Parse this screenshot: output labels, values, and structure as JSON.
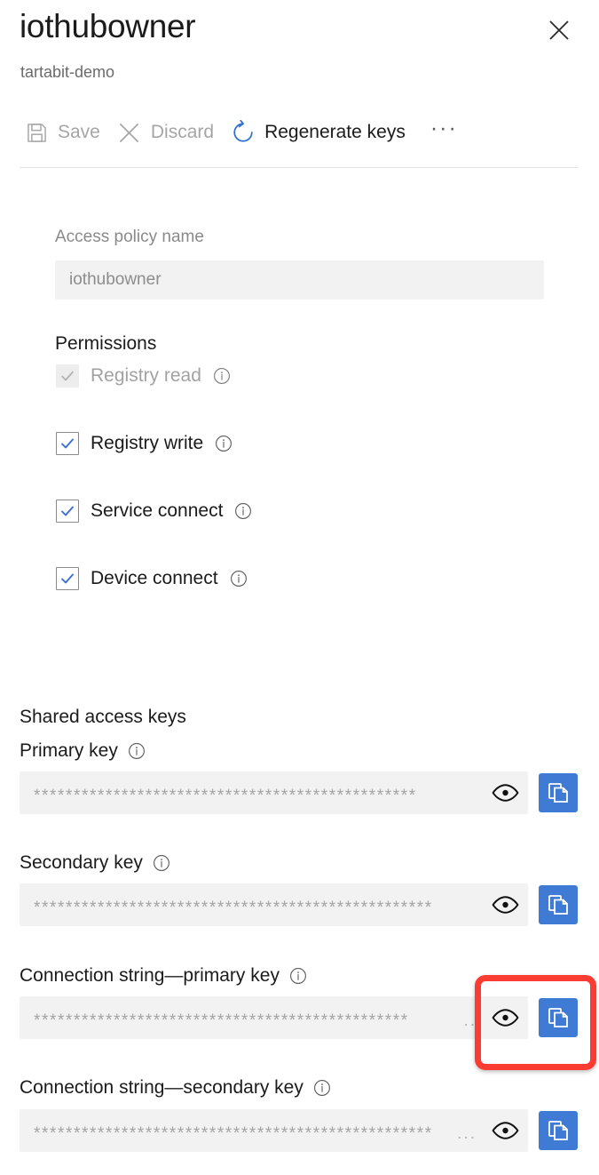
{
  "header": {
    "title": "iothubowner",
    "subtitle": "tartabit-demo",
    "close_label": "Close"
  },
  "toolbar": {
    "save_label": "Save",
    "discard_label": "Discard",
    "regenerate_label": "Regenerate keys",
    "more_label": "···"
  },
  "form": {
    "policy_name_label": "Access policy name",
    "policy_name_value": "iothubowner",
    "permissions_label": "Permissions",
    "permissions": [
      {
        "label": "Registry read",
        "checked": true,
        "enabled": false
      },
      {
        "label": "Registry write",
        "checked": true,
        "enabled": true
      },
      {
        "label": "Service connect",
        "checked": true,
        "enabled": true
      },
      {
        "label": "Device connect",
        "checked": true,
        "enabled": true
      }
    ]
  },
  "keys": {
    "section_label": "Shared access keys",
    "items": [
      {
        "label": "Primary key",
        "masked_value": "************************************************",
        "truncation": ""
      },
      {
        "label": "Secondary key",
        "masked_value": "**************************************************",
        "truncation": ""
      },
      {
        "label": "Connection string—primary key",
        "masked_value": "***********************************************",
        "truncation": ".."
      },
      {
        "label": "Connection string—secondary key",
        "masked_value": "**************************************************",
        "truncation": "..."
      }
    ]
  },
  "colors": {
    "accent_blue": "#3f7ad4",
    "highlight_red": "#fa3c32",
    "field_gray": "#f2f2f2",
    "text_dark": "#1b1b1b",
    "text_muted": "#8a8a8a"
  }
}
